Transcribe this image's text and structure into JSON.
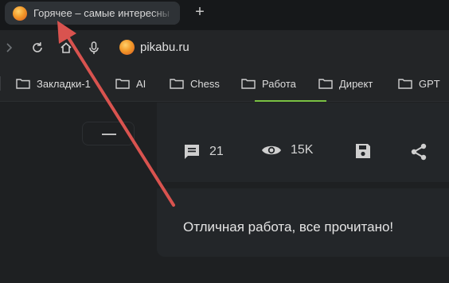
{
  "tab": {
    "title": "Горячее – самые интересны",
    "new_tab_label": "+"
  },
  "address_bar": {
    "url": "pikabu.ru"
  },
  "bookmarks": [
    {
      "label": "Закладки-1"
    },
    {
      "label": "AI"
    },
    {
      "label": "Chess"
    },
    {
      "label": "Работа"
    },
    {
      "label": "Директ"
    },
    {
      "label": "GPT"
    }
  ],
  "post_stats": {
    "comments": "21",
    "views": "15K"
  },
  "feed_end_message": "Отличная работа, все прочитано!",
  "colors": {
    "accent_green": "#7ac143",
    "annotation_red": "#d9534f"
  }
}
